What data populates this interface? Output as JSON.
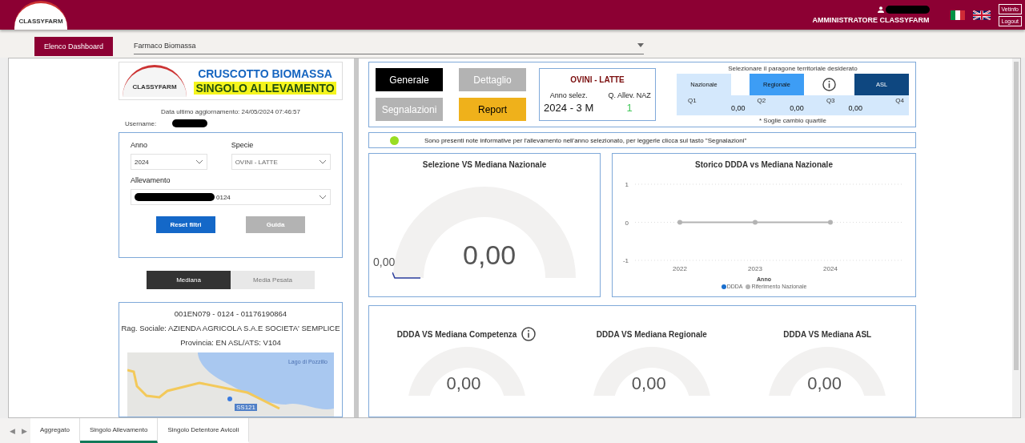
{
  "header": {
    "logo_text": "CLASSYFARM",
    "user_role": "AMMINISTRATORE CLASSYFARM",
    "buttons": [
      "Vetinfo",
      "Logout"
    ]
  },
  "toolbar": {
    "button": "Elenco Dashboard",
    "dropdown": "Farmaco Biomassa"
  },
  "left_panel": {
    "title": "CRUSCOTTO BIOMASSA",
    "subtitle": "SINGOLO ALLEVAMENTO",
    "logo_text": "CLASSYFARM",
    "updated": "Data ultimo aggiornamento: 24/05/2024 07:46:57",
    "username_label": "Username:",
    "filters": [
      {
        "label": "Anno",
        "value": "2024",
        "redacted": false
      },
      {
        "label": "Specie",
        "value": "OVINI - LATTE",
        "redacted": false
      },
      {
        "label": "Allevamento",
        "value": "0124",
        "redacted": true
      }
    ],
    "filter_buttons": [
      {
        "label": "Reset filtri",
        "kind": "primary"
      },
      {
        "label": "Guida",
        "kind": "secondary"
      }
    ],
    "toggle": [
      {
        "label": "Mediana",
        "selected": true
      },
      {
        "label": "Media Pesata",
        "selected": false
      }
    ],
    "farm": {
      "code": "001EN079 - 0124 - 01176190864",
      "name": "Rag. Sociale: AZIENDA AGRICOLA S.A.E SOCIETA' SEMPLICE",
      "location": "Provincia: EN  ASL/ATS: V104",
      "map_lake": "Lago di Pozzillo",
      "map_road": "SS121"
    }
  },
  "nav_buttons": [
    {
      "label": "Generale",
      "kind": "dark"
    },
    {
      "label": "Dettaglio",
      "kind": "muted"
    },
    {
      "label": "Segnalazioni",
      "kind": "muted"
    },
    {
      "label": "Report",
      "kind": "accent"
    }
  ],
  "summary": {
    "species": "OVINI - LATTE",
    "year_label": "Anno selez.",
    "quartile_label": "Q. Allev. NAZ",
    "year": "2024 - 3 M",
    "quartile": "1"
  },
  "comparison": {
    "title": "Selezionare il paragone territoriale desiderato",
    "options": [
      {
        "label": "Nazionale",
        "selected": true
      },
      {
        "label": "Regionale",
        "selected": false,
        "color": "#3d9df5"
      },
      {
        "label": "ASL",
        "selected": false,
        "color": "#0e4780"
      }
    ],
    "quartiles": [
      "Q1",
      "Q2",
      "Q3",
      "Q4"
    ],
    "thresholds": [
      "0,00",
      "0,00",
      "0,00"
    ],
    "note": "* Soglie cambio quartile"
  },
  "notice": {
    "text": "Sono presenti note informative per l'allevamento nell'anno selezionato, per leggerle clicca sul tasto \"Segnalazioni\"",
    "color": "#99dd22"
  },
  "main_gauge": {
    "title": "Selezione VS Mediana Nazionale",
    "min_label": "0,00",
    "value": "0,00"
  },
  "history": {
    "title": "Storico DDDA vs Mediana Nazionale",
    "chart_data": {
      "type": "line",
      "xlabel": "Anno",
      "categories": [
        "2022",
        "2023",
        "2024"
      ],
      "yticks": [
        -1,
        0,
        1
      ],
      "ylim": [
        -1,
        1
      ],
      "series": [
        {
          "name": "DDDA",
          "color": "#1a6fce",
          "values": [
            null,
            null,
            null
          ]
        },
        {
          "name": "Riferimento Nazionale",
          "color": "#b3b3b3",
          "marker": true,
          "values": [
            0,
            0,
            0
          ]
        }
      ]
    }
  },
  "gauges": [
    {
      "title": "DDDA VS Mediana Competenza",
      "info": true,
      "value": "0,00"
    },
    {
      "title": "DDDA VS Mediana Regionale",
      "info": false,
      "value": "0,00"
    },
    {
      "title": "DDDA VS Mediana ASL",
      "info": false,
      "value": "0,00"
    }
  ],
  "page_nav": [
    "◀",
    "▶"
  ],
  "page_tabs": [
    {
      "label": "Aggregato",
      "selected": false
    },
    {
      "label": "Singolo Allevamento",
      "selected": true
    },
    {
      "label": "Singolo Detentore Avicoli",
      "selected": false
    }
  ]
}
